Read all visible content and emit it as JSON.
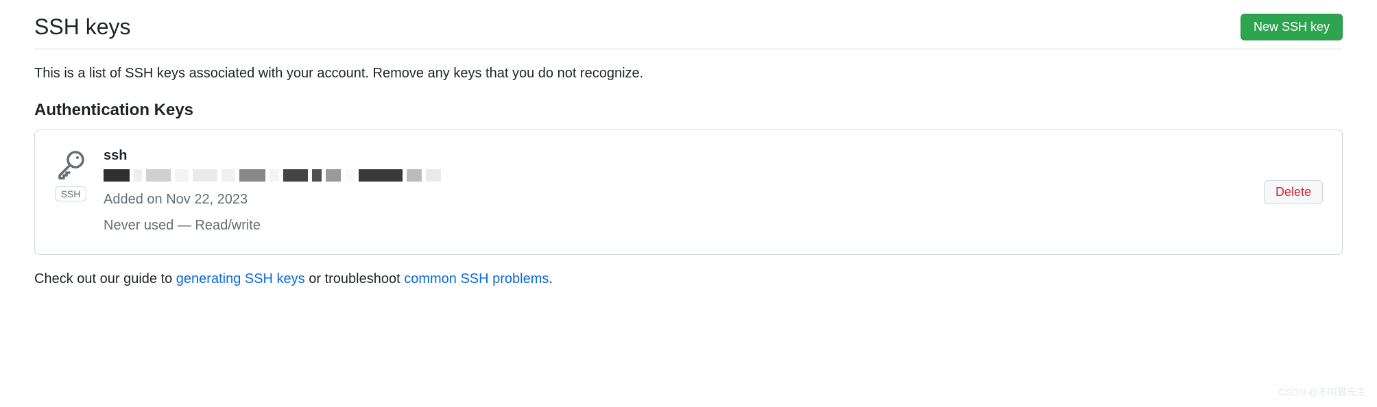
{
  "header": {
    "title": "SSH keys",
    "new_button": "New SSH key"
  },
  "description": "This is a list of SSH keys associated with your account. Remove any keys that you do not recognize.",
  "section_heading": "Authentication Keys",
  "key": {
    "name": "ssh",
    "badge": "SSH",
    "added": "Added on Nov 22, 2023",
    "usage": "Never used — Read/write",
    "delete_label": "Delete"
  },
  "footer": {
    "prefix": "Check out our guide to ",
    "link1": "generating SSH keys",
    "middle": " or troubleshoot ",
    "link2": "common SSH problems",
    "suffix": "."
  },
  "watermark": "CSDN @不叫猫先生"
}
